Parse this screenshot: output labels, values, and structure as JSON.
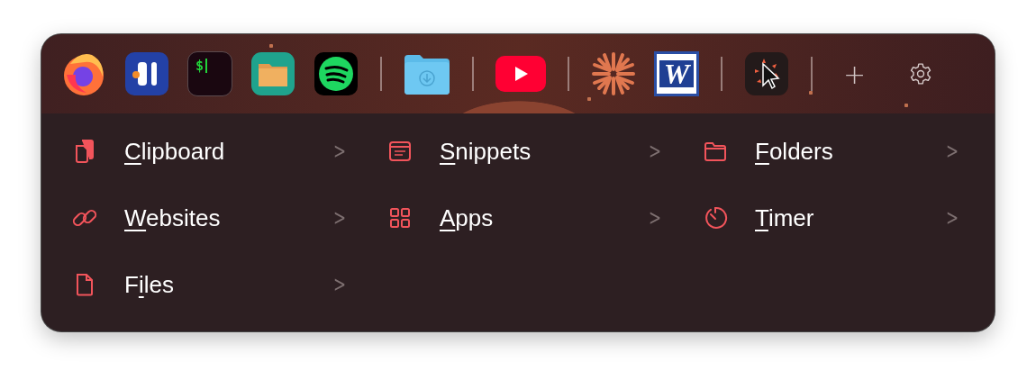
{
  "toolbar": {
    "groups": [
      [
        {
          "kind": "firefox"
        },
        {
          "kind": "ide"
        },
        {
          "kind": "terminal",
          "glyph": "$"
        },
        {
          "kind": "files-app"
        },
        {
          "kind": "spotify"
        }
      ],
      [
        {
          "kind": "downloads"
        }
      ],
      [
        {
          "kind": "youtube"
        }
      ],
      [
        {
          "kind": "burst"
        },
        {
          "kind": "word",
          "glyph": "W"
        }
      ],
      [
        {
          "kind": "cursor"
        }
      ]
    ],
    "add": "+"
  },
  "menu": [
    {
      "kind": "clipboard",
      "key": "C",
      "after": "lipboard",
      "chevron": ">"
    },
    {
      "kind": "snippets",
      "key": "S",
      "after": "nippets",
      "chevron": ">"
    },
    {
      "kind": "folder",
      "key": "F",
      "after": "olders",
      "chevron": ">"
    },
    {
      "kind": "link",
      "key": "W",
      "after": "ebsites",
      "chevron": ">"
    },
    {
      "kind": "apps",
      "key": "A",
      "after": "pps",
      "chevron": ">"
    },
    {
      "kind": "timer",
      "key": "T",
      "after": "imer",
      "chevron": ">"
    },
    {
      "kind": "file",
      "before": "F",
      "key": "i",
      "after": "les",
      "chevron": ">"
    }
  ]
}
